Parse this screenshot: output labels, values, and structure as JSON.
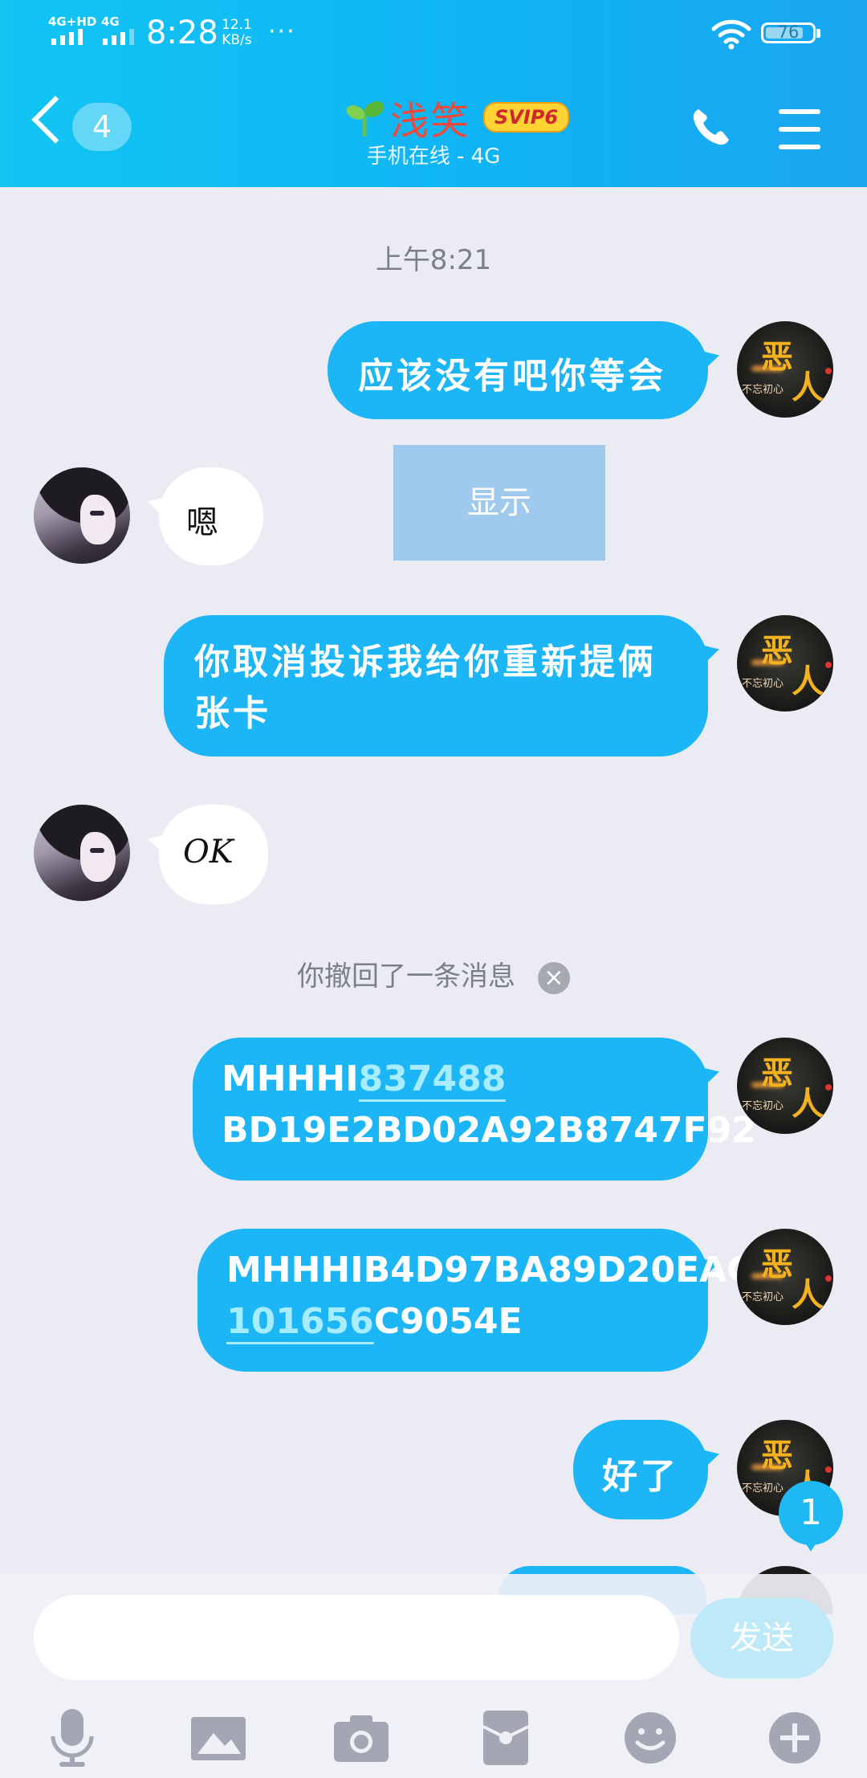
{
  "status_bar": {
    "network_1": "4G+HD",
    "network_2": "4G",
    "time": "8:28",
    "speed_value": "12.1",
    "speed_unit": "KB/s",
    "more": "···",
    "battery": "76"
  },
  "header": {
    "unread_count": "4",
    "contact_name": "浅笑",
    "vip_badge": "SVIP6",
    "online_status": "手机在线 - 4G"
  },
  "chat": {
    "timestamp": "上午8:21",
    "overlay_button": "显示",
    "recall_notice": "你撤回了一条消息",
    "messages": [
      {
        "from": "me",
        "text": "应该没有吧你等会"
      },
      {
        "from": "other",
        "text": "嗯"
      },
      {
        "from": "me",
        "line1": "你取消投诉我给你重新提俩",
        "line2": "张卡"
      },
      {
        "from": "other",
        "text": "OK"
      },
      {
        "from": "me",
        "line1_plain": "MHHHI",
        "line1_link": "837488",
        "line2": "BD19E2BD02A92B8747F92"
      },
      {
        "from": "me",
        "line1": "MHHHIB4D97BA89D20EAC",
        "line2_link": "101656",
        "line2_plain": "C9054E"
      },
      {
        "from": "me",
        "text": "好了"
      }
    ],
    "avatar_me": {
      "char1": "恶",
      "char2": "人",
      "caption": "不忘初心"
    },
    "floating_unread": "1"
  },
  "input": {
    "placeholder": "",
    "send_label": "发送"
  },
  "toolbar": {
    "icons": [
      "microphone-icon",
      "image-icon",
      "camera-icon",
      "red-packet-icon",
      "emoji-icon",
      "plus-icon"
    ]
  },
  "colors": {
    "header_gradient": [
      "#12c5f3",
      "#1aa6f1"
    ],
    "my_bubble": "#1cb5f6",
    "other_bubble": "#ffffff",
    "name_red": "#f0493a",
    "svip_yellow": "#ffd334"
  }
}
